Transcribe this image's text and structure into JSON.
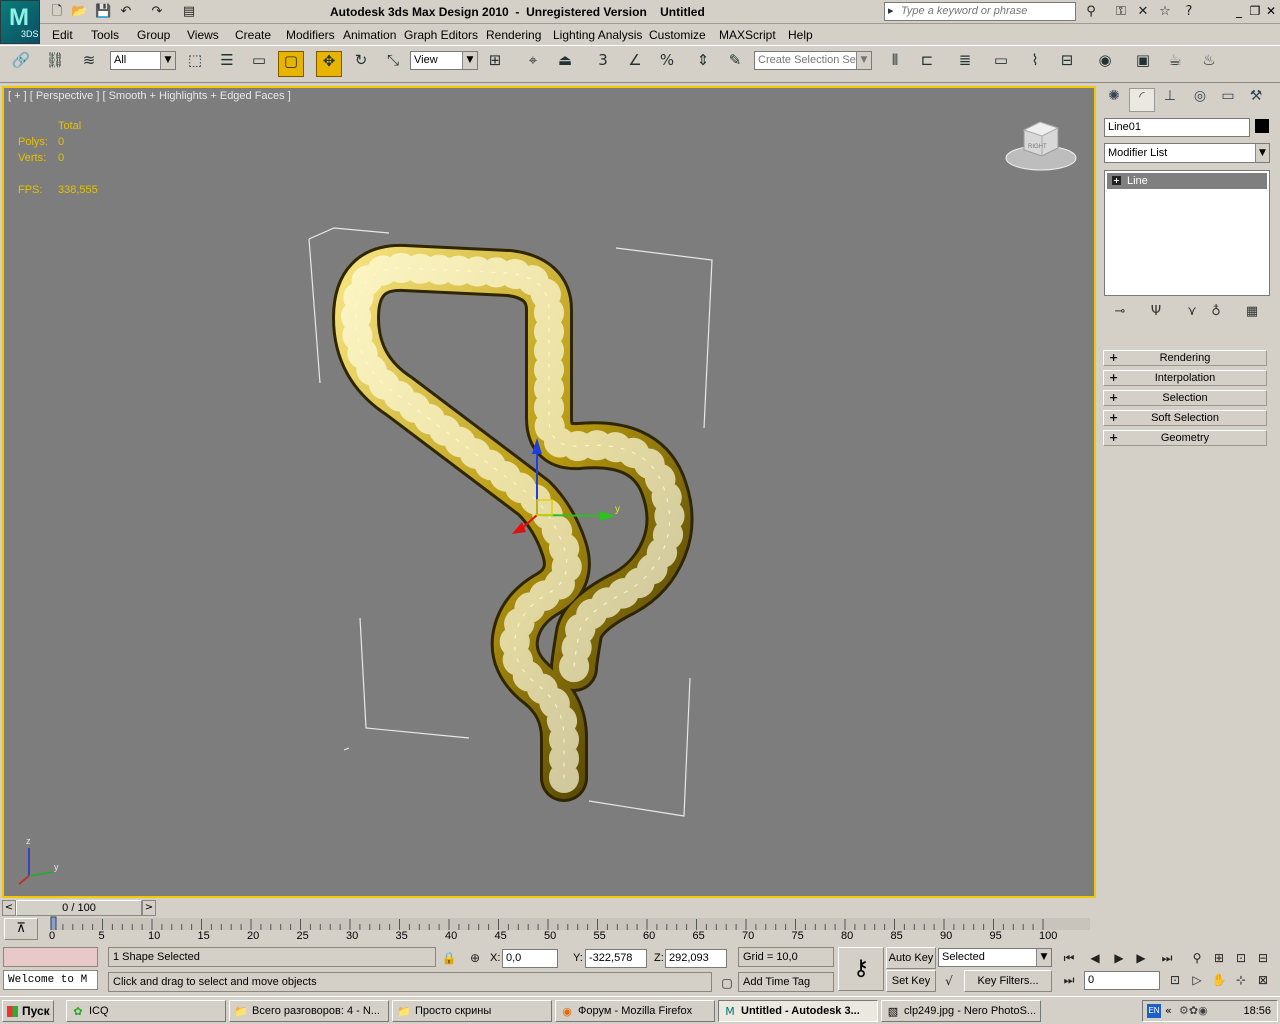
{
  "app": {
    "title_left": "Autodesk 3ds Max Design 2010",
    "title_mid": "Unregistered Version",
    "title_right": "Untitled",
    "logo_label": "3DS",
    "search_placeholder": "Type a keyword or phrase"
  },
  "menu": [
    "Edit",
    "Tools",
    "Group",
    "Views",
    "Create",
    "Modifiers",
    "Animation",
    "Graph Editors",
    "Rendering",
    "Lighting Analysis",
    "Customize",
    "MAXScript",
    "Help"
  ],
  "toolbar": {
    "selection_filter": "All",
    "ref_coord": "View",
    "snap_label": "3",
    "selection_set_placeholder": "Create Selection Se"
  },
  "viewport": {
    "label": "[ + ] [ Perspective ] [ Smooth + Highlights + Edged Faces ]",
    "stats": {
      "total_label": "Total",
      "polys_label": "Polys:",
      "polys_value": "0",
      "verts_label": "Verts:",
      "verts_value": "0",
      "fps_label": "FPS:",
      "fps_value": "338,555"
    },
    "viewcube_label": "RIGHT",
    "gizmo_labels": {
      "x": "x",
      "y": "y",
      "z": "z"
    },
    "shape_color": "#c8a800"
  },
  "command_panel": {
    "object_name": "Line01",
    "object_color": "#000000",
    "modifier_list": "Modifier List",
    "stack_item": "Line",
    "rollouts": [
      "Rendering",
      "Interpolation",
      "Selection",
      "Soft Selection",
      "Geometry"
    ]
  },
  "timeline": {
    "frame_display": "0 / 100",
    "ticks": [
      "0",
      "5",
      "10",
      "15",
      "20",
      "25",
      "30",
      "35",
      "40",
      "45",
      "50",
      "55",
      "60",
      "65",
      "70",
      "75",
      "80",
      "85",
      "90",
      "95",
      "100"
    ]
  },
  "status": {
    "maxscript_text": "Welcome to M",
    "selection_info": "1 Shape Selected",
    "prompt": "Click and drag to select and move objects",
    "x_label": "X:",
    "x_value": "0,0",
    "y_label": "Y:",
    "y_value": "-322,578",
    "z_label": "Z:",
    "z_value": "292,093",
    "grid": "Grid = 10,0",
    "add_time_tag": "Add Time Tag",
    "auto_key": "Auto Key",
    "set_key": "Set Key",
    "key_mode": "Selected",
    "key_filters": "Key Filters...",
    "current_frame": "0"
  },
  "taskbar": {
    "start": "Пуск",
    "tasks": [
      "ICQ",
      "Всего разговоров: 4 - N...",
      "Просто скрины",
      "Форум - Mozilla Firefox",
      "Untitled - Autodesk 3...",
      "clp249.jpg - Nero PhotoS..."
    ],
    "lang": "EN",
    "clock": "18:56"
  }
}
